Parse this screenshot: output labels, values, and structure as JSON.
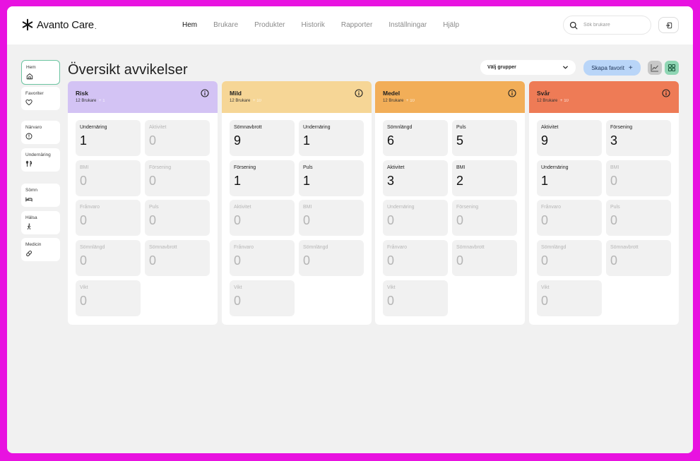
{
  "app": {
    "brand": "Avanto Care",
    "brand_suffix": "."
  },
  "nav": {
    "items": [
      "Hem",
      "Brukare",
      "Produkter",
      "Historik",
      "Rapporter",
      "Inställningar",
      "Hjälp"
    ],
    "active": "Hem"
  },
  "search": {
    "placeholder": "Sök brukare"
  },
  "sidebar": {
    "items": [
      {
        "label": "Hem",
        "icon": "home-icon",
        "active": true
      },
      {
        "label": "Favoriter",
        "icon": "heart-icon"
      },
      {
        "label": "Närvaro",
        "icon": "clock-icon"
      },
      {
        "label": "Undernäring",
        "icon": "cutlery-icon"
      },
      {
        "label": "Sömn",
        "icon": "bed-icon"
      },
      {
        "label": "Hälsa",
        "icon": "walking-person-icon"
      },
      {
        "label": "Medicin",
        "icon": "pill-icon"
      }
    ]
  },
  "main": {
    "title": "Översikt avvikelser",
    "group_select": "Välj grupper",
    "favorite_button": "Skapa favorit",
    "favorite_plus": "+",
    "columns": [
      {
        "title": "Risk",
        "count": "12 Brukare",
        "delta": "+ 1",
        "color": "#d3c3f4",
        "cards": [
          {
            "label": "Undernäring",
            "value": "1",
            "active": true
          },
          {
            "label": "Aktivitet",
            "value": "0",
            "active": false
          },
          {
            "label": "BMI",
            "value": "0",
            "active": false
          },
          {
            "label": "Försening",
            "value": "0",
            "active": false
          },
          {
            "label": "Frånvaro",
            "value": "0",
            "active": false
          },
          {
            "label": "Puls",
            "value": "0",
            "active": false
          },
          {
            "label": "Sömnlängd",
            "value": "0",
            "active": false
          },
          {
            "label": "Sömnavbrott",
            "value": "0",
            "active": false
          },
          {
            "label": "Vikt",
            "value": "0",
            "active": false
          }
        ]
      },
      {
        "title": "Mild",
        "count": "12 Brukare",
        "delta": "+ 10",
        "color": "#f6d696",
        "cards": [
          {
            "label": "Sömnavbrott",
            "value": "9",
            "active": true
          },
          {
            "label": "Undernäring",
            "value": "1",
            "active": true
          },
          {
            "label": "Försening",
            "value": "1",
            "active": true
          },
          {
            "label": "Puls",
            "value": "1",
            "active": true
          },
          {
            "label": "Aktivitet",
            "value": "0",
            "active": false
          },
          {
            "label": "BMI",
            "value": "0",
            "active": false
          },
          {
            "label": "Frånvaro",
            "value": "0",
            "active": false
          },
          {
            "label": "Sömnlängd",
            "value": "0",
            "active": false
          },
          {
            "label": "Vikt",
            "value": "0",
            "active": false
          }
        ]
      },
      {
        "title": "Medel",
        "count": "12 Brukare",
        "delta": "+ 10",
        "color": "#f2ae58",
        "cards": [
          {
            "label": "Sömnlängd",
            "value": "6",
            "active": true
          },
          {
            "label": "Puls",
            "value": "5",
            "active": true
          },
          {
            "label": "Aktivitet",
            "value": "3",
            "active": true
          },
          {
            "label": "BMI",
            "value": "2",
            "active": true
          },
          {
            "label": "Undernäring",
            "value": "0",
            "active": false
          },
          {
            "label": "Försening",
            "value": "0",
            "active": false
          },
          {
            "label": "Frånvaro",
            "value": "0",
            "active": false
          },
          {
            "label": "Sömnavbrott",
            "value": "0",
            "active": false
          },
          {
            "label": "Vikt",
            "value": "0",
            "active": false
          }
        ]
      },
      {
        "title": "Svår",
        "count": "12 Brukare",
        "delta": "+ 10",
        "color": "#ee7b56",
        "cards": [
          {
            "label": "Aktivitet",
            "value": "9",
            "active": true
          },
          {
            "label": "Försening",
            "value": "3",
            "active": true
          },
          {
            "label": "Undernäring",
            "value": "1",
            "active": true
          },
          {
            "label": "BMI",
            "value": "0",
            "active": false
          },
          {
            "label": "Frånvaro",
            "value": "0",
            "active": false
          },
          {
            "label": "Puls",
            "value": "0",
            "active": false
          },
          {
            "label": "Sömnlängd",
            "value": "0",
            "active": false
          },
          {
            "label": "Sömnavbrott",
            "value": "0",
            "active": false
          },
          {
            "label": "Vikt",
            "value": "0",
            "active": false
          }
        ]
      }
    ]
  }
}
